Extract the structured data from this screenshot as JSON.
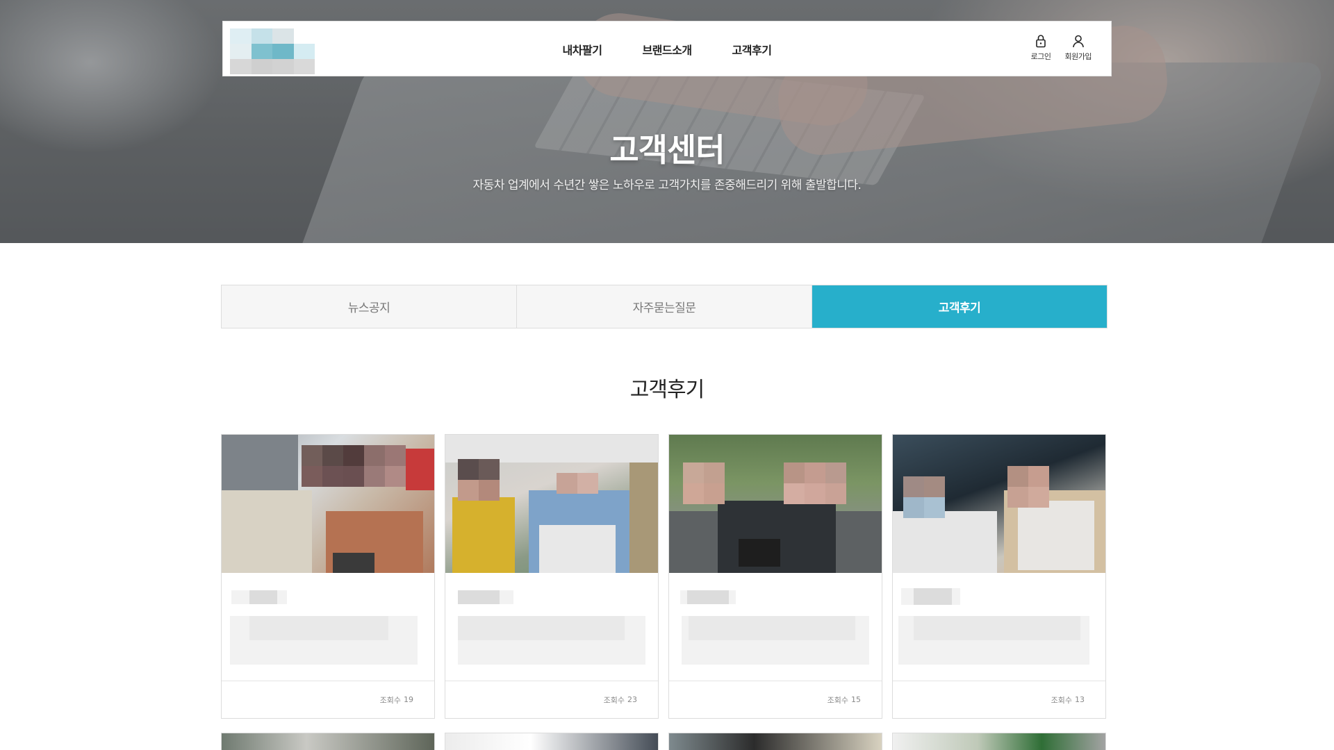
{
  "header": {
    "nav": [
      {
        "label": "내차팔기"
      },
      {
        "label": "브랜드소개"
      },
      {
        "label": "고객후기"
      }
    ],
    "login_label": "로그인",
    "signup_label": "회원가입"
  },
  "hero": {
    "title": "고객센터",
    "subtitle": "자동차 업계에서 수년간 쌓은 노하우로 고객가치를 존중해드리기 위해 출발합니다."
  },
  "tabs": [
    {
      "label": "뉴스공지",
      "active": false
    },
    {
      "label": "자주묻는질문",
      "active": false
    },
    {
      "label": "고객후기",
      "active": true
    }
  ],
  "section": {
    "title": "고객후기"
  },
  "cards": [
    {
      "views_label": "조회수",
      "views": "19"
    },
    {
      "views_label": "조회수",
      "views": "23"
    },
    {
      "views_label": "조회수",
      "views": "15"
    },
    {
      "views_label": "조회수",
      "views": "13"
    }
  ],
  "colors": {
    "accent": "#27afcb",
    "tab_bg": "#f6f6f6",
    "border": "#dddddd"
  },
  "icons": {
    "login": "lock-icon",
    "signup": "user-icon"
  }
}
